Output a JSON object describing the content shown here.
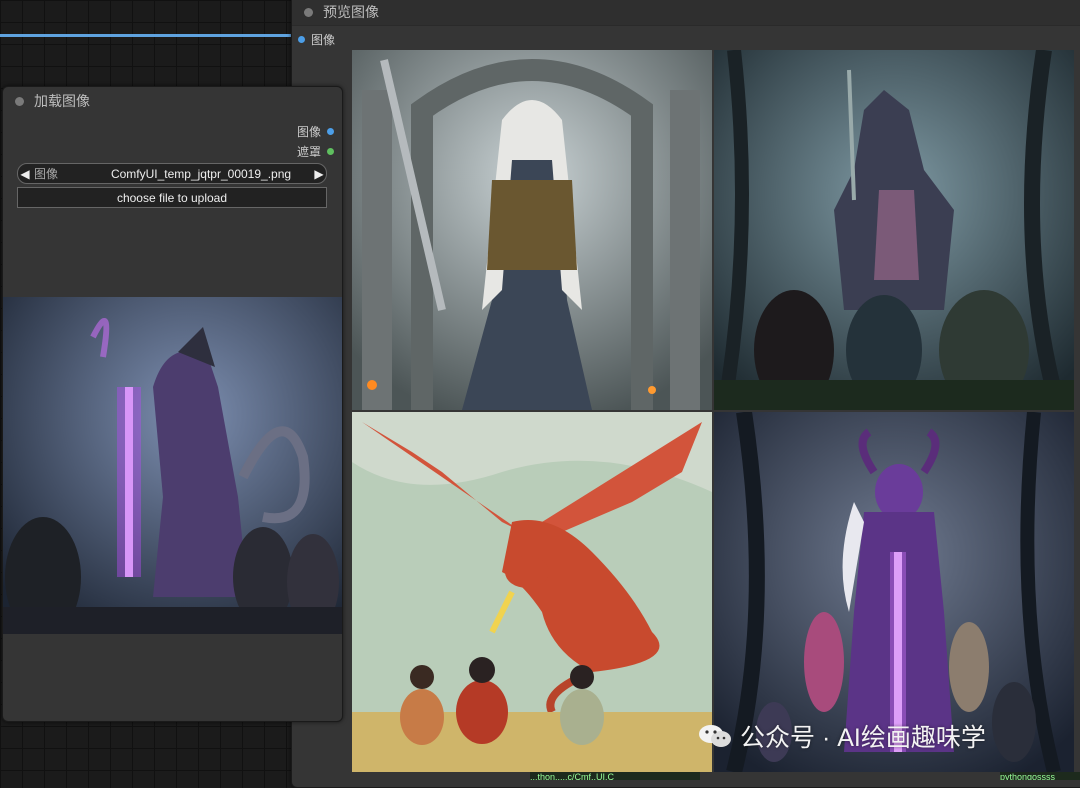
{
  "preview_node": {
    "title": "预览图像",
    "input_label": "图像",
    "images": [
      "elf-warrior",
      "demon-with-children",
      "red-dragon-cartoon",
      "purple-demon-sword"
    ]
  },
  "load_node": {
    "title": "加载图像",
    "outputs": [
      {
        "label": "图像",
        "color": "#4c9ee8"
      },
      {
        "label": "遮罩",
        "color": "#5fbf5f"
      }
    ],
    "image_widget": {
      "label": "图像",
      "value": "ComfyUI_temp_jqtpr_00019_.png"
    },
    "upload_label": "choose file to upload",
    "loaded_image": "dragon-glowing-sword"
  },
  "watermark": {
    "text": "公众号 · AI绘画趣味学",
    "icon": "wechat-icon"
  },
  "bottom_texts": [
    "...thon.....c/Cmf..UI.C",
    "pythongossss"
  ],
  "colors": {
    "wire": "#5fa3e0",
    "image_dot": "#4c9ee8",
    "mask_dot": "#5fbf5f"
  }
}
